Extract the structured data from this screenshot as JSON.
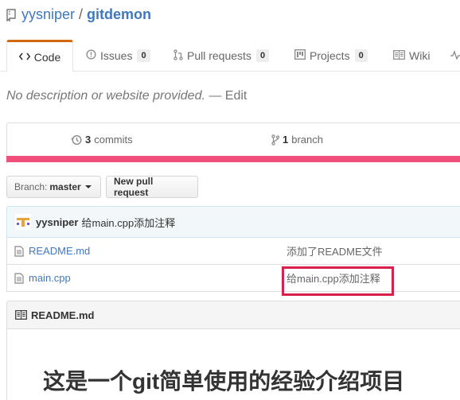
{
  "header": {
    "owner": "yysniper",
    "separator": "/",
    "repo": "gitdemon"
  },
  "tabs": [
    {
      "label": "Code",
      "selected": true
    },
    {
      "label": "Issues",
      "count": "0"
    },
    {
      "label": "Pull requests",
      "count": "0"
    },
    {
      "label": "Projects",
      "count": "0"
    },
    {
      "label": "Wiki"
    }
  ],
  "description": {
    "text": "No description or website provided.",
    "dash": " — ",
    "edit": "Edit"
  },
  "summary": {
    "commits_count": "3",
    "commits_label": "commits",
    "branch_count": "1",
    "branch_label": "branch"
  },
  "language_color": "#f1507c",
  "branch_select": {
    "label": "Branch:",
    "value": "master"
  },
  "new_pr": "New pull request",
  "latest_commit": {
    "author": "yysniper",
    "message": "给main.cpp添加注释"
  },
  "files": [
    {
      "name": "README.md",
      "message": "添加了README文件"
    },
    {
      "name": "main.cpp",
      "message": "给main.cpp添加注释"
    }
  ],
  "highlight_color": "#d8204a",
  "readme": {
    "title": "README.md",
    "heading": "这是一个git简单使用的经验介绍项目"
  }
}
